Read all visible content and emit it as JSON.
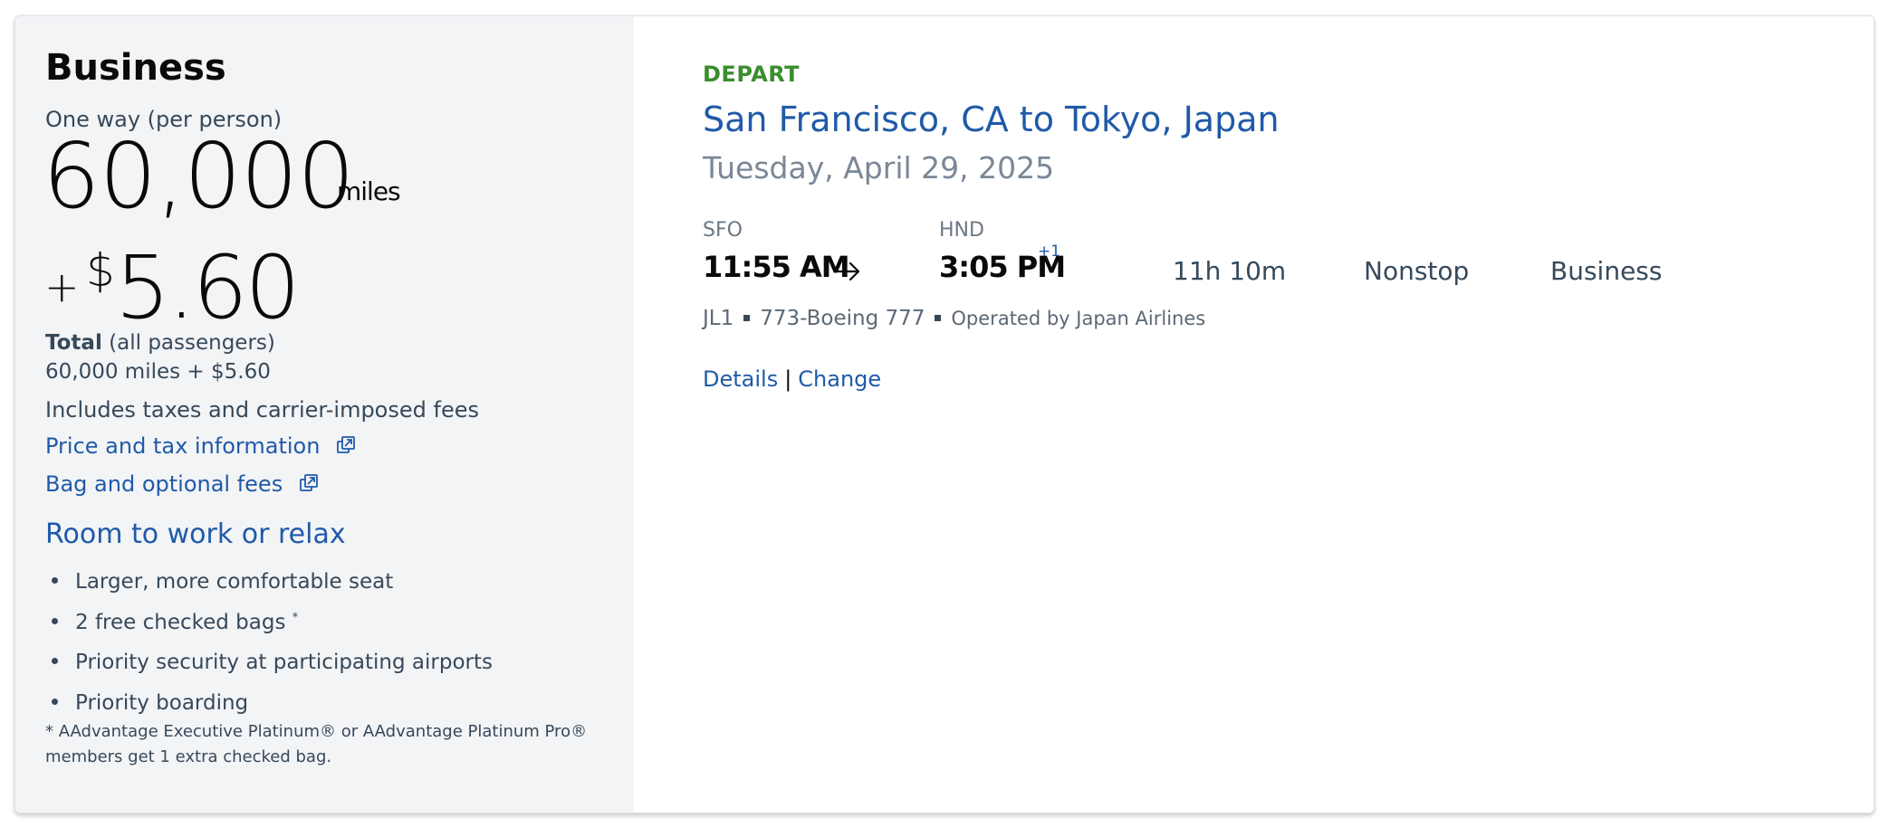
{
  "fare": {
    "cabin": "Business",
    "trip_type": "One way (per person)",
    "miles": "60,000",
    "miles_unit": "miles",
    "plus": "+",
    "currency": "$",
    "cash": "5.60",
    "total_label": "Total",
    "total_suffix": "(all passengers)",
    "total_value": "60,000 miles + $5.60",
    "includes": "Includes taxes and carrier-imposed fees",
    "price_link": "Price and tax information",
    "bag_link": "Bag and optional fees",
    "benefits_title": "Room to work or relax",
    "benefits": [
      "Larger, more comfortable seat",
      "2 free checked bags",
      "Priority security at participating airports",
      "Priority boarding"
    ],
    "asterisk": "*",
    "footnote": "* AAdvantage Executive Platinum® or AAdvantage Platinum Pro® members get 1 extra checked bag."
  },
  "flight": {
    "direction": "DEPART",
    "route": "San Francisco, CA to Tokyo, Japan",
    "date": "Tuesday, April 29, 2025",
    "origin_code": "SFO",
    "dest_code": "HND",
    "depart_time": "11:55 AM",
    "arrive_time": "3:05 PM",
    "day_offset": "+1",
    "duration": "11h 10m",
    "stops": "Nonstop",
    "cabin": "Business",
    "flight_number": "JL1",
    "aircraft": "773-Boeing 777",
    "operated_by": "Operated by Japan Airlines",
    "details_link": "Details",
    "separator": "|",
    "change_link": "Change"
  },
  "icons": {
    "external": "external-link-icon",
    "arrow": "arrow-right-icon"
  },
  "colors": {
    "link": "#1f5aa8",
    "depart_green": "#3a8d2e",
    "panel_bg": "#f3f4f6",
    "text": "#36495a"
  }
}
